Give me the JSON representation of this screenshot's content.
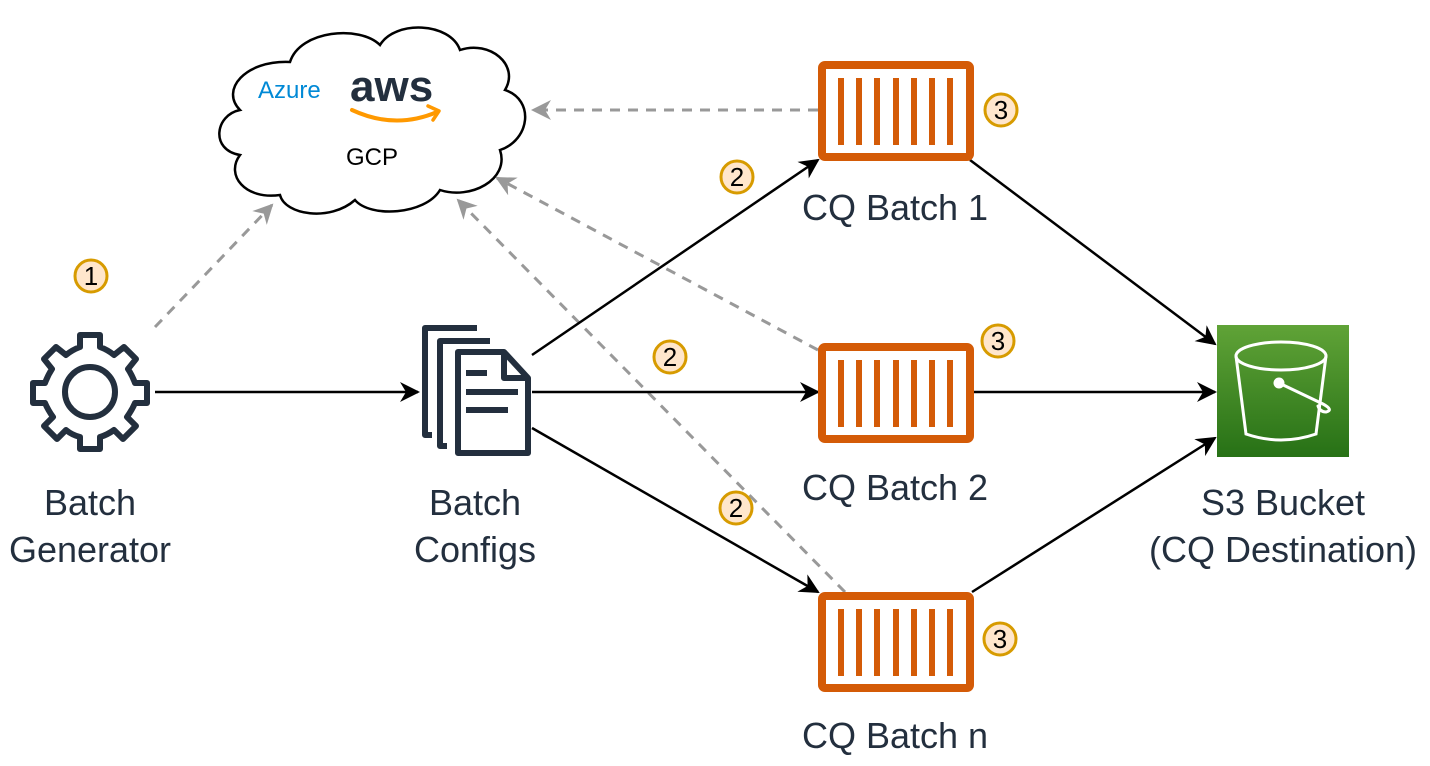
{
  "diagram": {
    "cloud": {
      "providers": {
        "azure": "Azure",
        "aws": "aws",
        "gcp": "GCP"
      }
    },
    "nodes": {
      "batch_generator": {
        "line1": "Batch",
        "line2": "Generator",
        "icon": "gear-icon"
      },
      "batch_configs": {
        "line1": "Batch",
        "line2": "Configs",
        "icon": "documents-icon"
      },
      "cq_batch_1": {
        "label": "CQ Batch 1",
        "icon": "container-icon"
      },
      "cq_batch_2": {
        "label": "CQ Batch 2",
        "icon": "container-icon"
      },
      "cq_batch_n": {
        "label": "CQ Batch n",
        "icon": "container-icon"
      },
      "s3_bucket": {
        "line1": "S3 Bucket",
        "line2": "(CQ Destination)",
        "icon": "bucket-icon"
      }
    },
    "badges": {
      "step1": "1",
      "step2": "2",
      "step3": "3"
    },
    "edges": [
      {
        "from": "Batch Generator",
        "to": "Batch Configs",
        "style": "solid"
      },
      {
        "from": "Batch Configs",
        "to": "CQ Batch 1",
        "style": "solid"
      },
      {
        "from": "Batch Configs",
        "to": "CQ Batch 2",
        "style": "solid"
      },
      {
        "from": "Batch Configs",
        "to": "CQ Batch n",
        "style": "solid"
      },
      {
        "from": "CQ Batch 1",
        "to": "S3 Bucket",
        "style": "solid"
      },
      {
        "from": "CQ Batch 2",
        "to": "S3 Bucket",
        "style": "solid"
      },
      {
        "from": "CQ Batch n",
        "to": "S3 Bucket",
        "style": "solid"
      },
      {
        "from": "Batch Generator",
        "to": "Cloud",
        "style": "dashed"
      },
      {
        "from": "CQ Batch 1",
        "to": "Cloud",
        "style": "dashed"
      },
      {
        "from": "CQ Batch 2",
        "to": "Cloud",
        "style": "dashed"
      },
      {
        "from": "CQ Batch n",
        "to": "Cloud",
        "style": "dashed"
      }
    ],
    "colors": {
      "text": "#232f3e",
      "container_orange": "#d45b07",
      "bucket_green_top": "#60a337",
      "bucket_green_bottom": "#277116",
      "badge_fill": "#ffe6cc",
      "badge_stroke": "#d79b00",
      "dashed_gray": "#999999",
      "azure_blue": "#0089d6",
      "aws_orange": "#ff9900"
    }
  }
}
